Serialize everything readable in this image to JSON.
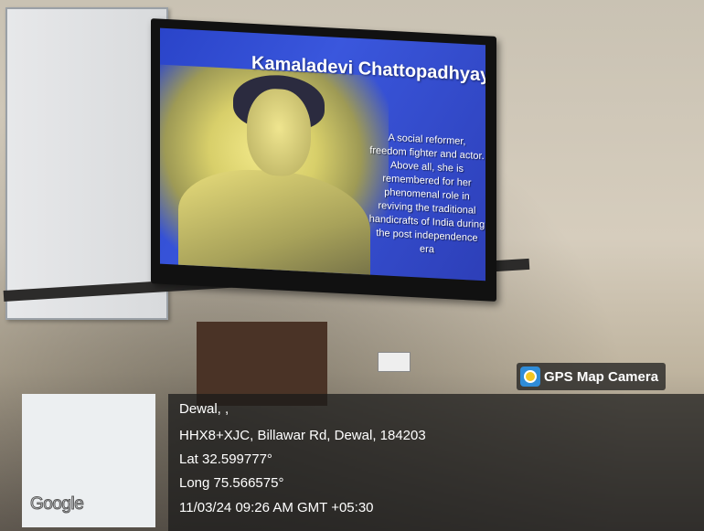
{
  "slide": {
    "title": "Kamaladevi Chattopadhyay",
    "description": "A social reformer, freedom fighter and actor. Above all, she is remembered for her phenomenal role in reviving the traditional handicrafts of India during the post independence era"
  },
  "gps": {
    "badge_label": "GPS Map Camera",
    "place": "Dewal, ,",
    "address": "HHX8+XJC, Billawar Rd, Dewal, 184203",
    "latitude": "Lat 32.599777°",
    "longitude": "Long 75.566575°",
    "timestamp": "11/03/24 09:26 AM GMT +05:30"
  },
  "map": {
    "logo": "Google"
  },
  "icons": {
    "gps_app": "gps-map-camera-icon"
  },
  "colors": {
    "screen_blue": "#2a44c9",
    "overlay": "#191919"
  }
}
